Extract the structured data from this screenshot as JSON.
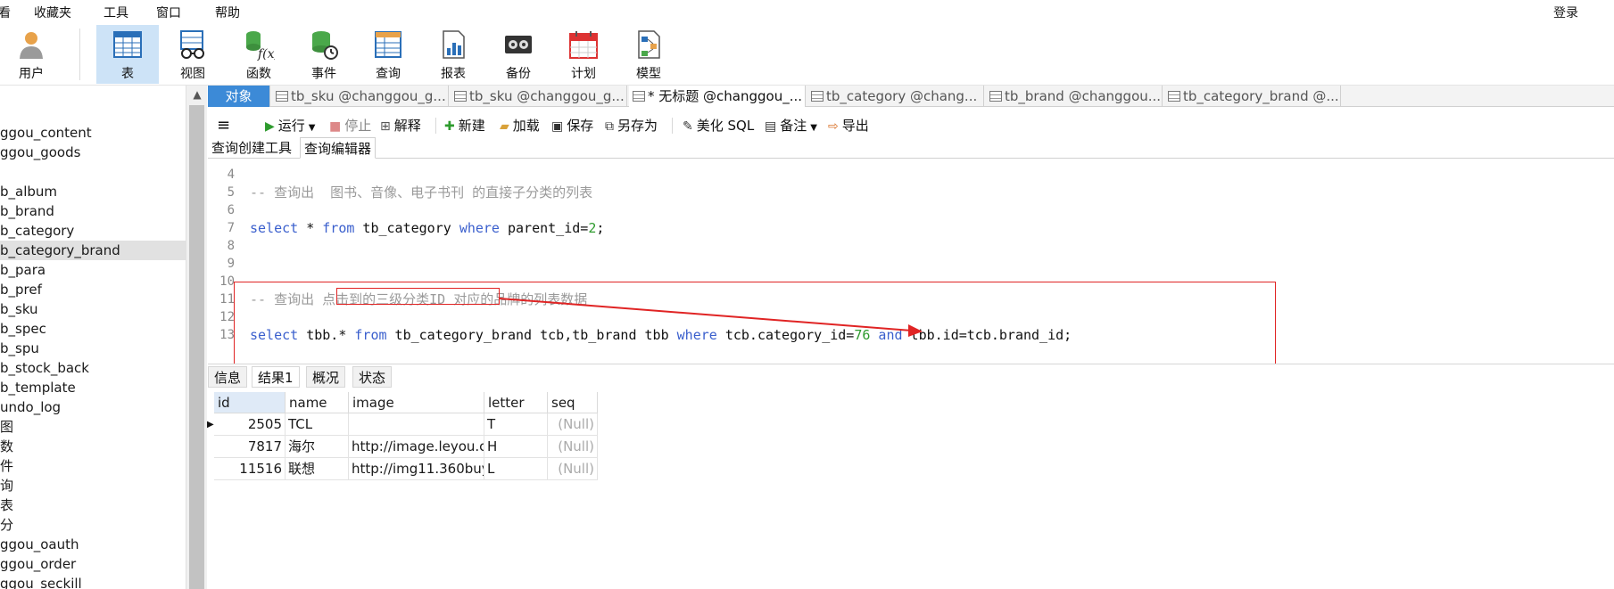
{
  "menu": {
    "items": [
      "看",
      "收藏夹",
      "工具",
      "窗口",
      "帮助"
    ],
    "login": "登录"
  },
  "ribbon": {
    "buttons": [
      {
        "label": "用户",
        "icon": "user-icon"
      },
      {
        "label": "表",
        "icon": "table-icon",
        "active": true
      },
      {
        "label": "视图",
        "icon": "view-icon"
      },
      {
        "label": "函数",
        "icon": "function-icon"
      },
      {
        "label": "事件",
        "icon": "event-icon"
      },
      {
        "label": "查询",
        "icon": "query-icon"
      },
      {
        "label": "报表",
        "icon": "report-icon"
      },
      {
        "label": "备份",
        "icon": "backup-icon"
      },
      {
        "label": "计划",
        "icon": "schedule-icon"
      },
      {
        "label": "模型",
        "icon": "model-icon"
      }
    ]
  },
  "tree": {
    "items": [
      "ggou_content",
      "ggou_goods",
      "",
      "b_album",
      "b_brand",
      "b_category",
      "b_category_brand",
      "b_para",
      "b_pref",
      "b_sku",
      "b_spec",
      "b_spu",
      "b_stock_back",
      "b_template",
      "undo_log",
      "图",
      "数",
      "件",
      "询",
      "表",
      "分",
      "ggou_oauth",
      "ggou_order",
      "ggou_seckill"
    ],
    "selected_index": 6
  },
  "tabs": {
    "items": [
      {
        "label": "对象",
        "type": "object"
      },
      {
        "label": "tb_sku @changgou_g...",
        "type": "table"
      },
      {
        "label": "tb_sku @changgou_g...",
        "type": "table-edit"
      },
      {
        "label": "* 无标题 @changgou_...",
        "type": "query",
        "current": true
      },
      {
        "label": "tb_category @chang...",
        "type": "table"
      },
      {
        "label": "tb_brand @changgou...",
        "type": "table"
      },
      {
        "label": "tb_category_brand @...",
        "type": "table"
      }
    ]
  },
  "toolbar": {
    "menu_label": "≡",
    "run": "运行",
    "stop": "停止",
    "explain": "解释",
    "new": "新建",
    "load": "加载",
    "save": "保存",
    "save_as": "另存为",
    "beautify": "美化 SQL",
    "note": "备注",
    "export": "导出"
  },
  "subtabs": {
    "builder": "查询创建工具",
    "editor": "查询编辑器"
  },
  "editor": {
    "lines": [
      {
        "n": "4",
        "parts": []
      },
      {
        "n": "5",
        "parts": [
          {
            "t": "-- 查询出  图书、音像、电子书刊 的直接子分类的列表",
            "c": "cm"
          }
        ]
      },
      {
        "n": "6",
        "parts": []
      },
      {
        "n": "7",
        "parts": [
          {
            "t": "select",
            "c": "kw"
          },
          {
            "t": " * ",
            "c": ""
          },
          {
            "t": "from",
            "c": "kw"
          },
          {
            "t": " tb_category ",
            "c": ""
          },
          {
            "t": "where",
            "c": "kw"
          },
          {
            "t": " parent_id=",
            "c": ""
          },
          {
            "t": "2",
            "c": "nm"
          },
          {
            "t": ";",
            "c": ""
          }
        ]
      },
      {
        "n": "8",
        "parts": []
      },
      {
        "n": "9",
        "parts": []
      },
      {
        "n": "10",
        "parts": []
      },
      {
        "n": "11",
        "parts": [
          {
            "t": "-- 查询出 点击到的三级分类ID 对应的品牌的列表数据",
            "c": "cm"
          }
        ]
      },
      {
        "n": "12",
        "parts": []
      },
      {
        "n": "13",
        "parts": [
          {
            "t": "select",
            "c": "kw"
          },
          {
            "t": " tbb.* ",
            "c": ""
          },
          {
            "t": "from",
            "c": "kw"
          },
          {
            "t": " tb_category_brand tcb,tb_brand tbb ",
            "c": ""
          },
          {
            "t": "where",
            "c": "kw"
          },
          {
            "t": " tcb.category_id=",
            "c": ""
          },
          {
            "t": "76",
            "c": "nm"
          },
          {
            "t": " ",
            "c": ""
          },
          {
            "t": "and",
            "c": "kw"
          },
          {
            "t": " tbb.id=tcb.brand_id;",
            "c": ""
          }
        ]
      }
    ]
  },
  "result_tabs": {
    "items": [
      "信息",
      "结果1",
      "概况",
      "状态"
    ],
    "current_index": 1
  },
  "grid": {
    "columns": [
      "id",
      "name",
      "image",
      "letter",
      "seq"
    ],
    "rows": [
      [
        "2505",
        "TCL",
        "",
        "T",
        "(Null)"
      ],
      [
        "7817",
        "海尔",
        "http://image.leyou.c",
        "H",
        "(Null)"
      ],
      [
        "11516",
        "联想",
        "http://img11.360buy",
        "L",
        "(Null)"
      ]
    ]
  },
  "colors": {
    "accent": "#3c8ad7",
    "annotation": "#e02424",
    "keyword": "#3a5fcd",
    "number": "#2e9b2e",
    "comment": "#9a9a9a"
  }
}
